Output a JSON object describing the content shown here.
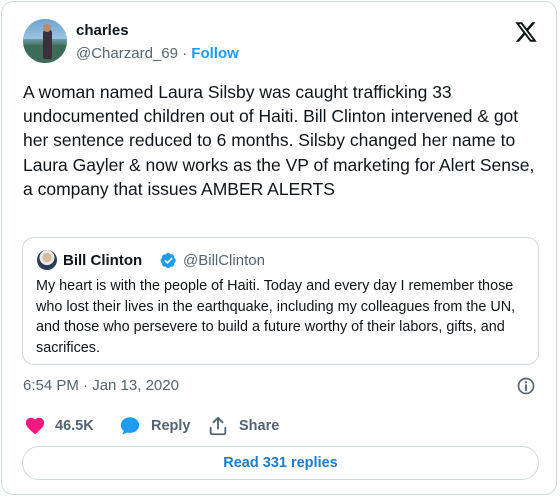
{
  "author": {
    "name": "charles",
    "handle": "@Charzard_69",
    "separator": "·",
    "follow_label": "Follow"
  },
  "tweet": {
    "text": "A woman named Laura Silsby was caught trafficking 33 undocumented children out of Haiti. Bill Clinton intervened & got her sentence reduced to 6 months. Silsby changed her name to Laura Gayler & now works as the VP of marketing for Alert Sense, a company that issues AMBER ALERTS",
    "timestamp": "6:54 PM · Jan 13, 2020"
  },
  "quote": {
    "name": "Bill Clinton",
    "handle": "@BillClinton",
    "verified": true,
    "text": "My heart is with the people of Haiti. Today and every day I remember those who lost their lives in the earthquake, including my colleagues from the UN, and those who persevere to build a future worthy of their labors, gifts, and sacrifices."
  },
  "actions": {
    "likes": "46.5K",
    "reply_label": "Reply",
    "share_label": "Share"
  },
  "read_replies_label": "Read 331 replies",
  "colors": {
    "accent": "#1d9bf0",
    "like": "#f91880",
    "text": "#0f1419",
    "muted": "#536471",
    "border": "#cfd9de"
  },
  "icons": {
    "brand": "x-logo-icon",
    "verified": "verified-badge-icon",
    "info": "info-icon",
    "like": "heart-icon",
    "reply": "reply-bubble-icon",
    "share": "share-upload-icon"
  }
}
